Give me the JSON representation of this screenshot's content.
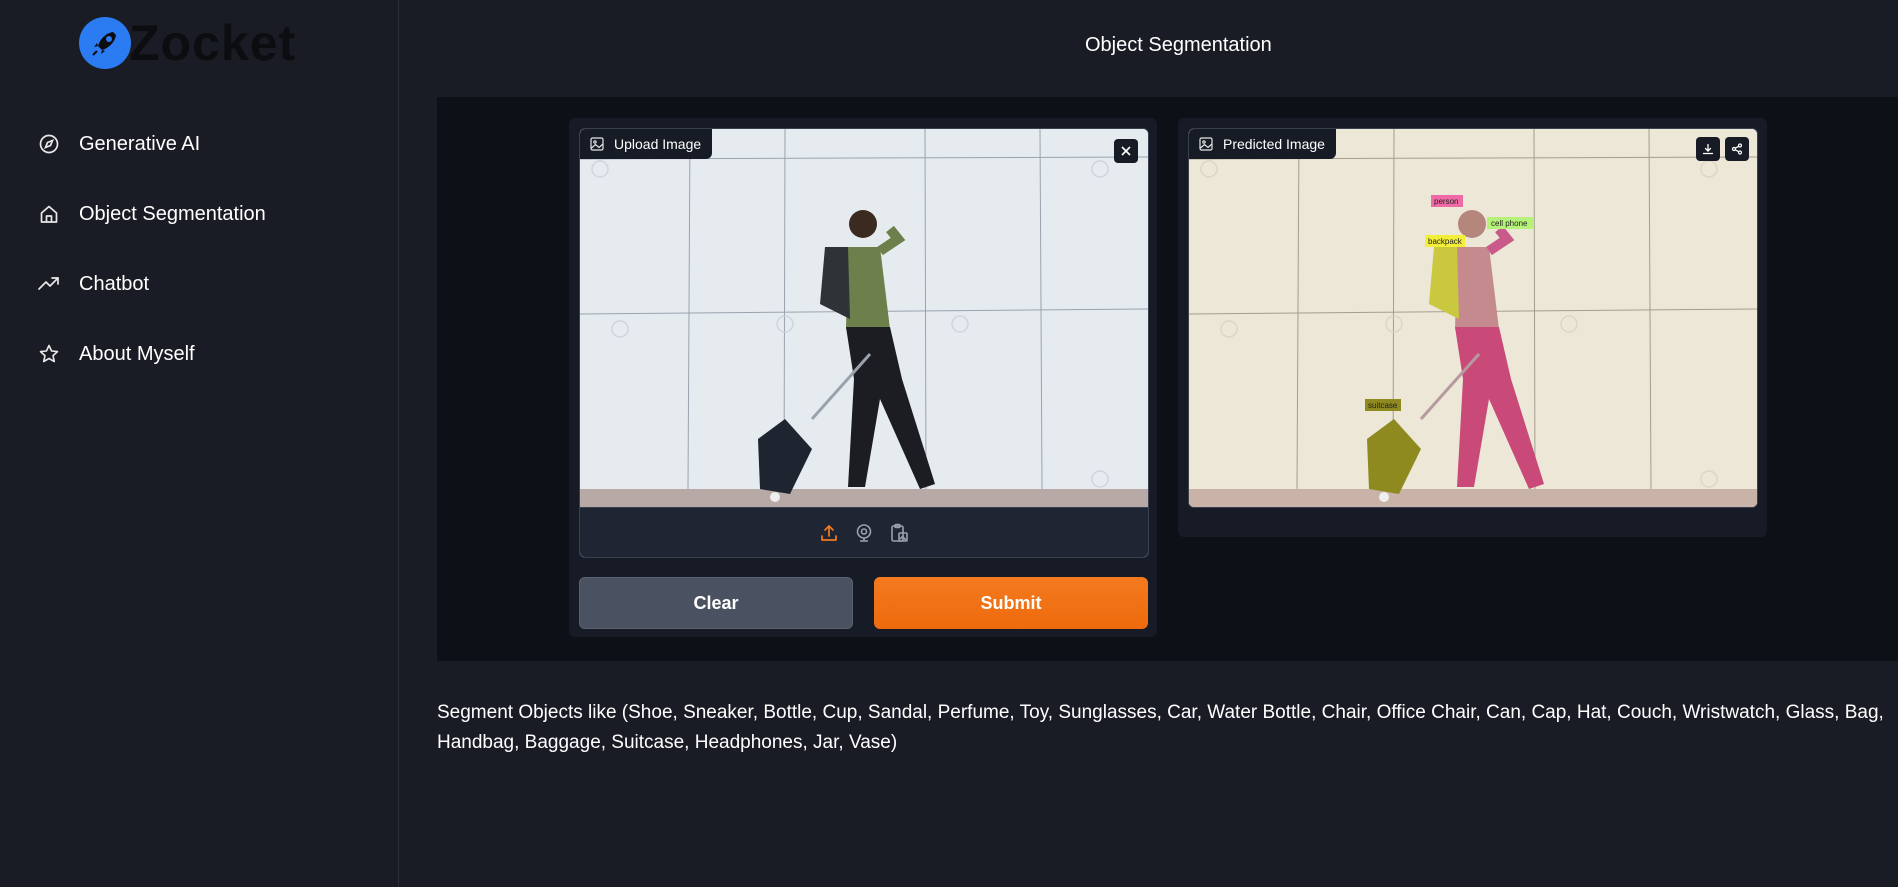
{
  "brand": {
    "name": "Zocket",
    "accent": "#2b7bf2"
  },
  "sidebar": {
    "items": [
      {
        "label": "Generative AI",
        "icon": "compass-icon"
      },
      {
        "label": "Object Segmentation",
        "icon": "home-icon"
      },
      {
        "label": "Chatbot",
        "icon": "trending-up-icon"
      },
      {
        "label": "About Myself",
        "icon": "star-icon"
      }
    ]
  },
  "main": {
    "title": "Object Segmentation",
    "upload": {
      "label": "Upload Image"
    },
    "predicted": {
      "label": "Predicted Image",
      "tags": [
        "person",
        "cell phone",
        "backpack",
        "suitcase"
      ]
    },
    "buttons": {
      "clear": "Clear",
      "submit": "Submit"
    },
    "description": "Segment Objects like (Shoe, Sneaker, Bottle, Cup, Sandal, Perfume, Toy, Sunglasses, Car, Water Bottle, Chair, Office Chair, Can, Cap, Hat, Couch, Wristwatch, Glass, Bag, Handbag, Baggage, Suitcase, Headphones, Jar, Vase)"
  },
  "colors": {
    "background": "#191c24",
    "panel": "#0d1017",
    "submit": "#ef6c10",
    "clear": "#4a5160",
    "person_mask": "#d6417a",
    "backpack_mask": "#c8c83a",
    "suitcase_mask": "#8a8a1c",
    "cellphone_tag": "#b6f27a"
  }
}
